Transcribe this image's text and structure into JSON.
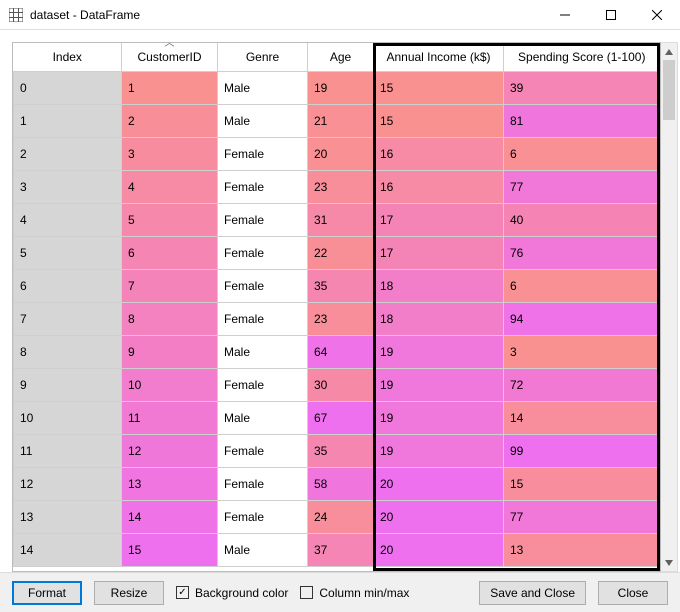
{
  "window": {
    "title": "dataset - DataFrame"
  },
  "table": {
    "sorted_column_index": 1,
    "columns": [
      "Index",
      "CustomerID",
      "Genre",
      "Age",
      "Annual Income (k$)",
      "Spending Score (1-100)"
    ],
    "color_scales": {
      "CustomerID": {
        "min": 1,
        "max": 15
      },
      "Age": {
        "min": 19,
        "max": 67
      },
      "Annual Income (k$)": {
        "min": 15,
        "max": 20
      },
      "Spending Score (1-100)": {
        "min": 3,
        "max": 99
      },
      "low_color": "#f99191",
      "high_color": "#ee70ee"
    },
    "rows": [
      {
        "Index": 0,
        "CustomerID": 1,
        "Genre": "Male",
        "Age": 19,
        "Annual Income (k$)": 15,
        "Spending Score (1-100)": 39
      },
      {
        "Index": 1,
        "CustomerID": 2,
        "Genre": "Male",
        "Age": 21,
        "Annual Income (k$)": 15,
        "Spending Score (1-100)": 81
      },
      {
        "Index": 2,
        "CustomerID": 3,
        "Genre": "Female",
        "Age": 20,
        "Annual Income (k$)": 16,
        "Spending Score (1-100)": 6
      },
      {
        "Index": 3,
        "CustomerID": 4,
        "Genre": "Female",
        "Age": 23,
        "Annual Income (k$)": 16,
        "Spending Score (1-100)": 77
      },
      {
        "Index": 4,
        "CustomerID": 5,
        "Genre": "Female",
        "Age": 31,
        "Annual Income (k$)": 17,
        "Spending Score (1-100)": 40
      },
      {
        "Index": 5,
        "CustomerID": 6,
        "Genre": "Female",
        "Age": 22,
        "Annual Income (k$)": 17,
        "Spending Score (1-100)": 76
      },
      {
        "Index": 6,
        "CustomerID": 7,
        "Genre": "Female",
        "Age": 35,
        "Annual Income (k$)": 18,
        "Spending Score (1-100)": 6
      },
      {
        "Index": 7,
        "CustomerID": 8,
        "Genre": "Female",
        "Age": 23,
        "Annual Income (k$)": 18,
        "Spending Score (1-100)": 94
      },
      {
        "Index": 8,
        "CustomerID": 9,
        "Genre": "Male",
        "Age": 64,
        "Annual Income (k$)": 19,
        "Spending Score (1-100)": 3
      },
      {
        "Index": 9,
        "CustomerID": 10,
        "Genre": "Female",
        "Age": 30,
        "Annual Income (k$)": 19,
        "Spending Score (1-100)": 72
      },
      {
        "Index": 10,
        "CustomerID": 11,
        "Genre": "Male",
        "Age": 67,
        "Annual Income (k$)": 19,
        "Spending Score (1-100)": 14
      },
      {
        "Index": 11,
        "CustomerID": 12,
        "Genre": "Female",
        "Age": 35,
        "Annual Income (k$)": 19,
        "Spending Score (1-100)": 99
      },
      {
        "Index": 12,
        "CustomerID": 13,
        "Genre": "Female",
        "Age": 58,
        "Annual Income (k$)": 20,
        "Spending Score (1-100)": 15
      },
      {
        "Index": 13,
        "CustomerID": 14,
        "Genre": "Female",
        "Age": 24,
        "Annual Income (k$)": 20,
        "Spending Score (1-100)": 77
      },
      {
        "Index": 14,
        "CustomerID": 15,
        "Genre": "Male",
        "Age": 37,
        "Annual Income (k$)": 20,
        "Spending Score (1-100)": 13
      }
    ]
  },
  "footer": {
    "format_label": "Format",
    "resize_label": "Resize",
    "bgcolor_label": "Background color",
    "bgcolor_checked": true,
    "minmax_label": "Column min/max",
    "minmax_checked": false,
    "save_label": "Save and Close",
    "close_label": "Close"
  },
  "icons": {
    "grid": "grid-icon",
    "chevron_up": "▲",
    "chevron_down": "▼",
    "check": "✓"
  }
}
